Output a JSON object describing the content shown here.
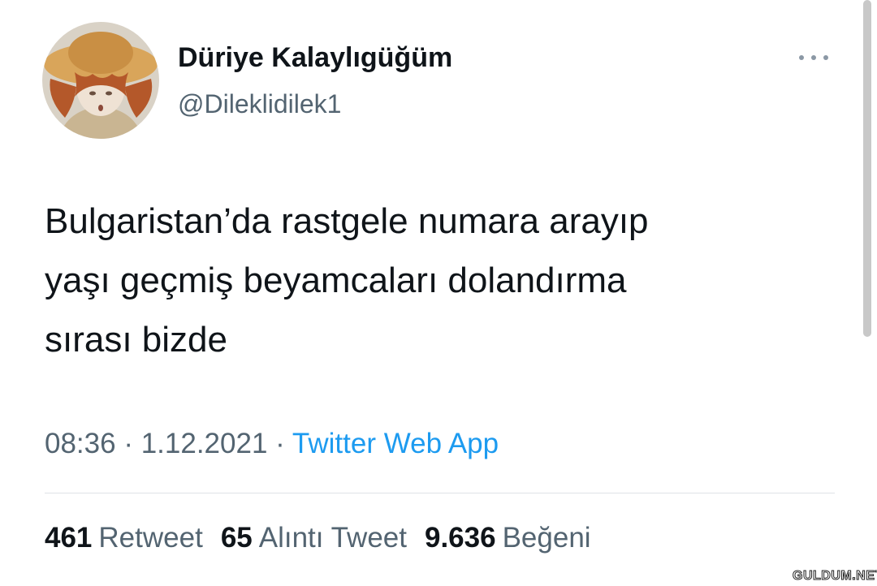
{
  "author": {
    "display_name": "Düriye Kalaylıgüğüm",
    "handle": "@Dileklidilek1"
  },
  "tweet": {
    "text": "Bulgaristan’da rastgele numara arayıp\nyaşı geçmiş beyamcaları dolandırma\nsırası bizde"
  },
  "meta": {
    "time": "08:36",
    "sep1": " · ",
    "date": "1.12.2021",
    "sep2": " · ",
    "source": "Twitter Web App"
  },
  "stats": {
    "retweets": {
      "count": "461",
      "label": "Retweet"
    },
    "quotes": {
      "count": "65",
      "label": "Alıntı Tweet"
    },
    "likes": {
      "count": "9.636",
      "label": "Beğeni"
    }
  },
  "watermark": "GULDUM.NET",
  "colors": {
    "text": "#0f1419",
    "secondary": "#536471",
    "link": "#1d9bf0",
    "divider": "#dfe3e6"
  },
  "icons": {
    "more": "more-horizontal-icon"
  }
}
